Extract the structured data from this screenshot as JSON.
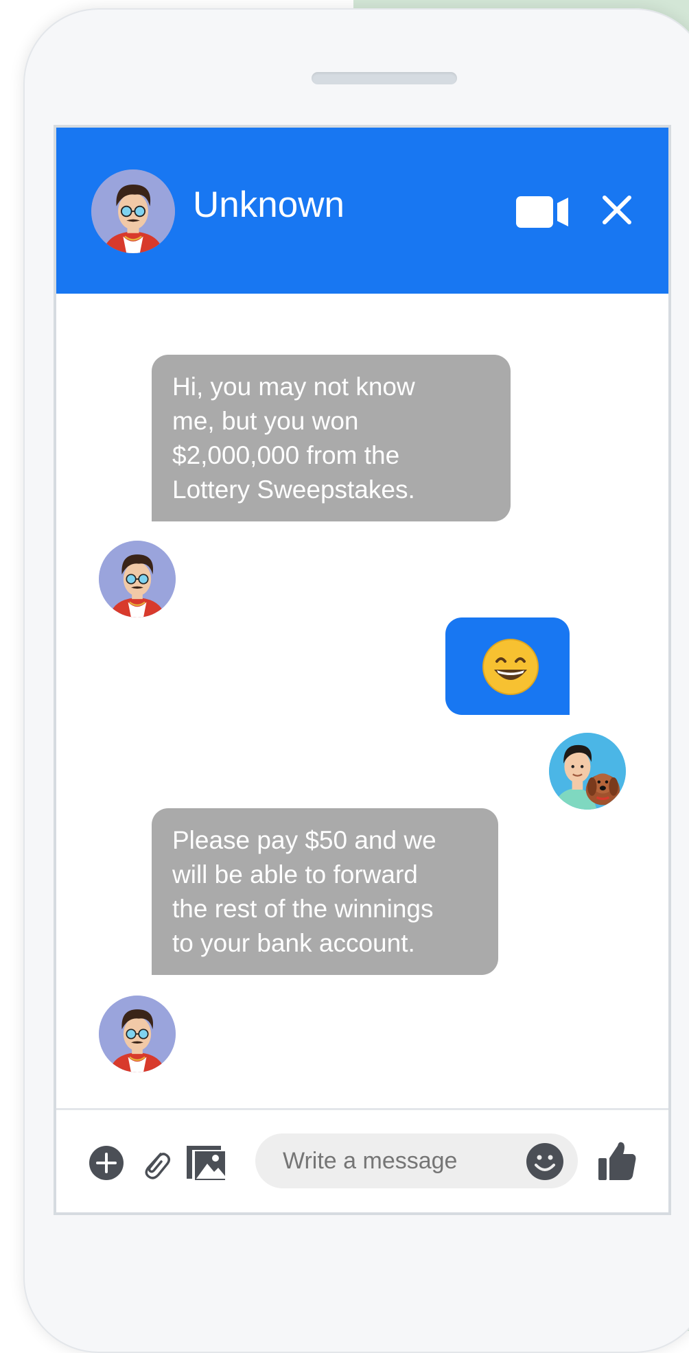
{
  "header": {
    "contact_name": "Unknown"
  },
  "messages": [
    {
      "sender": "them",
      "text": "Hi, you may not know\nme, but you won\n$2,000,000 from the\nLottery Sweepstakes."
    },
    {
      "sender": "me",
      "emoji": "grinning-face-icon"
    },
    {
      "sender": "them",
      "text": "Please pay $50 and we\nwill be able to forward\nthe rest of the winnings\nto your bank account."
    }
  ],
  "composer": {
    "placeholder": "Write a message"
  },
  "icons": [
    "video-camera-icon",
    "close-icon",
    "plus-icon",
    "paperclip-icon",
    "image-icon",
    "smiley-icon",
    "thumbs-up-icon"
  ],
  "colors": {
    "accent": "#1877f2",
    "incoming_bubble": "#aaaaaa"
  }
}
